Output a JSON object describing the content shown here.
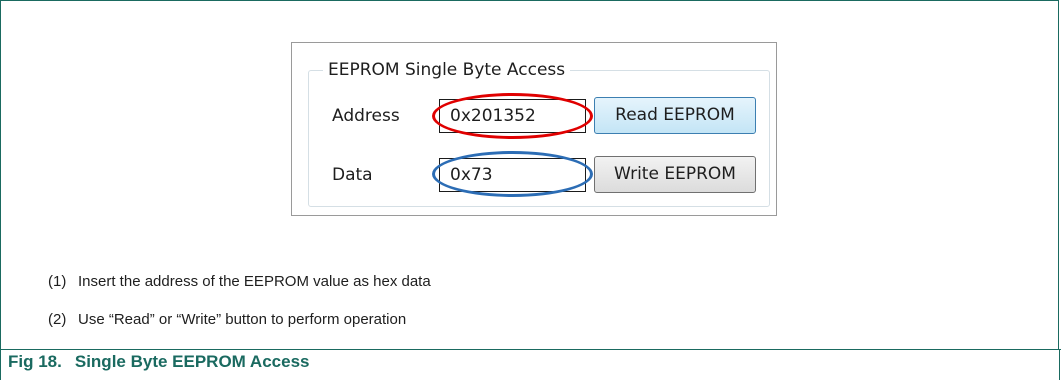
{
  "panel": {
    "group_title": "EEPROM Single Byte Access",
    "address_label": "Address",
    "address_value": "0x201352",
    "data_label": "Data",
    "data_value": "0x73",
    "read_button": "Read EEPROM",
    "write_button": "Write EEPROM",
    "highlight_colors": {
      "address": "#e00000",
      "data": "#2c6db5"
    }
  },
  "notes": [
    {
      "num": "(1)",
      "text": "Insert the address of the EEPROM value as hex data"
    },
    {
      "num": "(2)",
      "text": "Use “Read” or “Write” button to perform operation"
    }
  ],
  "caption": {
    "number": "Fig 18.",
    "title": "Single Byte EEPROM Access"
  },
  "theme": {
    "frame_color": "#1a6a60"
  }
}
